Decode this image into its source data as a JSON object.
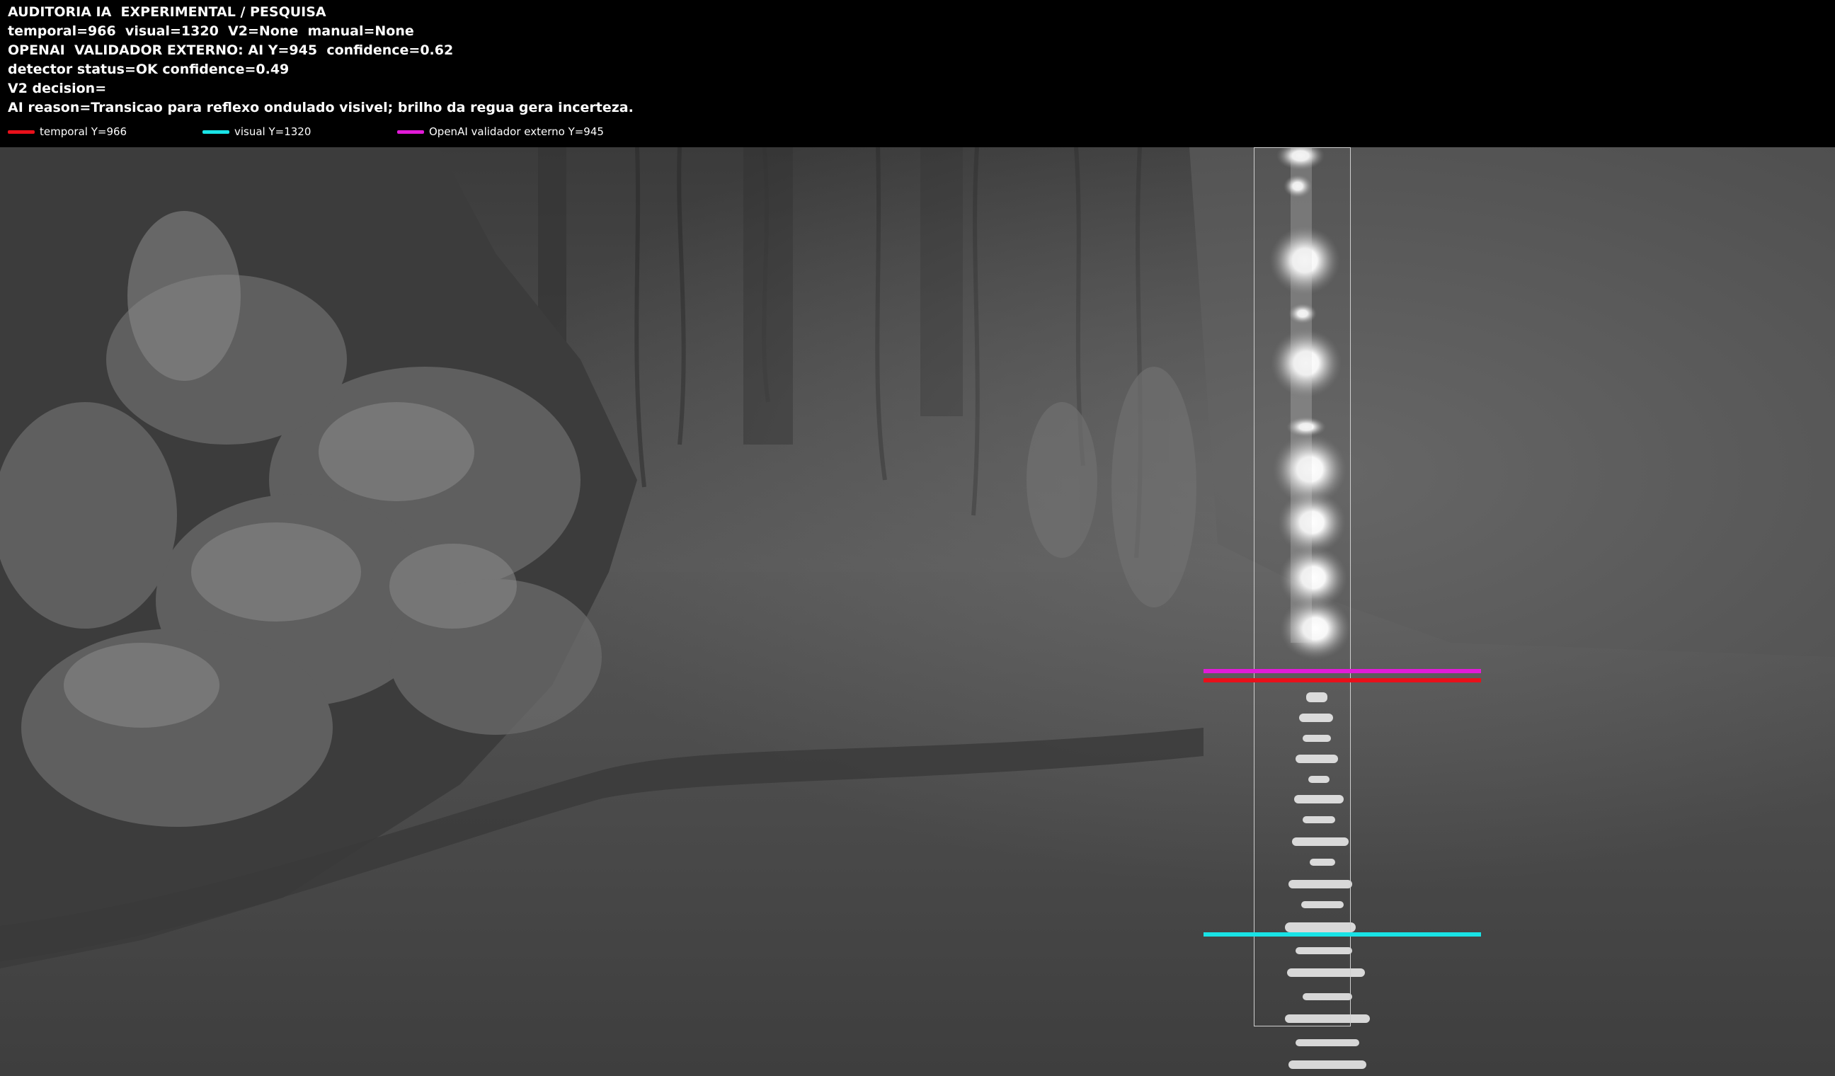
{
  "header": {
    "lines": [
      "AUDITORIA IA  EXPERIMENTAL / PESQUISA",
      "temporal=966  visual=1320  V2=None  manual=None",
      "OPENAI  VALIDADOR EXTERNO: AI Y=945  confidence=0.62",
      "detector status=OK confidence=0.49",
      "V2 decision=",
      "AI reason=Transicao para reflexo ondulado visivel; brilho da regua gera incerteza."
    ],
    "legend": [
      {
        "label": "temporal Y=966",
        "color": "#e8101a"
      },
      {
        "label": "visual Y=1320",
        "color": "#19e3e6"
      },
      {
        "label": "OpenAI validador externo Y=945",
        "color": "#e21ad8"
      }
    ]
  },
  "markers": {
    "temporal": {
      "color": "#e8101a"
    },
    "visual": {
      "color": "#19e3e6"
    },
    "openai": {
      "color": "#e21ad8"
    }
  }
}
